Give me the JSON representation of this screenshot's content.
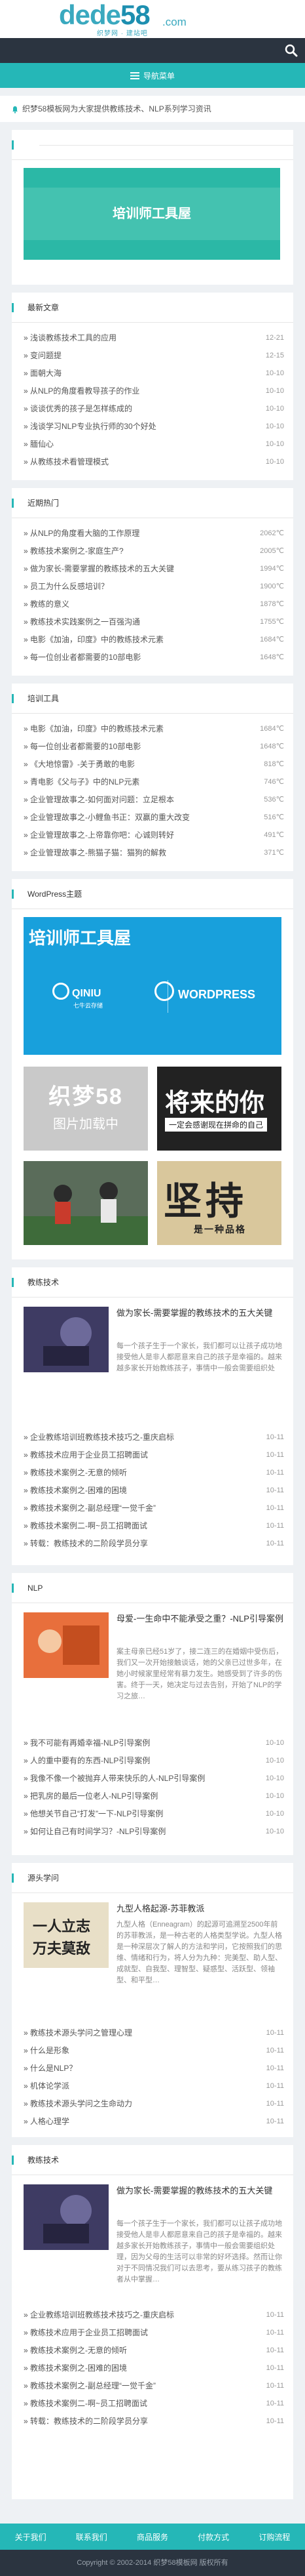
{
  "header": {
    "logo_main": "dede",
    "logo_num": "58",
    "logo_domain": ".com",
    "logo_tag": "织梦网 · 建站吧"
  },
  "nav": {
    "label": "导航菜单"
  },
  "notice": {
    "text": "织梦58模板网为大家提供教练技术、NLP系列学习资讯"
  },
  "banner": {
    "text": "培训师工具屋"
  },
  "latest": {
    "title": "最新文章",
    "items": [
      {
        "t": "浅谈教练技术工具的应用",
        "v": "12-21"
      },
      {
        "t": "变问题提",
        "v": "12-15"
      },
      {
        "t": "面朝大海",
        "v": "10-10"
      },
      {
        "t": "从NLP的角度看教导孩子的作业",
        "v": "10-10"
      },
      {
        "t": "谈谈优秀的孩子是怎样练成的",
        "v": "10-10"
      },
      {
        "t": "浅谈学习NLP专业执行师的30个好处",
        "v": "10-10"
      },
      {
        "t": "腼仙心",
        "v": "10-10"
      },
      {
        "t": "从教练技术看管理模式",
        "v": "10-10"
      }
    ]
  },
  "hot": {
    "title": "近期热门",
    "items": [
      {
        "t": "从NLP的角度看大脑的工作原理",
        "v": "2062℃"
      },
      {
        "t": "教练技术案例之-家庭生产?",
        "v": "2005℃"
      },
      {
        "t": "做为家长-需要掌握的教练技术的五大关键",
        "v": "1994℃"
      },
      {
        "t": "员工为什么反感培训？",
        "v": "1900℃"
      },
      {
        "t": "教练的意义",
        "v": "1878℃"
      },
      {
        "t": "教练技术实践案例之一百强沟通",
        "v": "1755℃"
      },
      {
        "t": "电影《加油，印度》中的教练技术元素",
        "v": "1684℃"
      },
      {
        "t": "每一位创业者都需要的10部电影",
        "v": "1648℃"
      }
    ]
  },
  "tools": {
    "title": "培训工具",
    "items": [
      {
        "t": "电影《加油，印度》中的教练技术元素",
        "v": "1684℃"
      },
      {
        "t": "每一位创业者都需要的10部电影",
        "v": "1648℃"
      },
      {
        "t": "《大地惊雷》-关于勇敢的电影",
        "v": "818℃"
      },
      {
        "t": "青电影《父与子》中的NLP元素",
        "v": "746℃"
      },
      {
        "t": "企业管理故事之-如何面对问题：立足根本",
        "v": "536℃"
      },
      {
        "t": "企业管理故事之-小鲤鱼书正：双赢的重大改变",
        "v": "516℃"
      },
      {
        "t": "企业管理故事之-上帝靠你吧：心诚则转好",
        "v": "491℃"
      },
      {
        "t": "企业管理故事之-熊猫子猫：猫狗的解救",
        "v": "371℃"
      }
    ]
  },
  "wp": {
    "title": "WordPress主题",
    "ad_title": "培训师工具屋",
    "qiniu": "QINIU",
    "qiniu_sub": "七牛云存储",
    "wordpress": "WORDPRESS",
    "grey_t1": "织梦58",
    "grey_t2": "图片加载中",
    "dark_t1": "将来的你",
    "dark_t2": "一定会感谢现在拼命的自己",
    "gold_t1": "坚持",
    "gold_t2": "是一种品格"
  },
  "coach": {
    "title": "教练技术",
    "headline": "做为家长-需要掌握的教练技术的五大关键",
    "summary": "每一个孩子生于一个家长，我们都可以让孩子成功地接受他人是非人都愿意来自己的孩子是幸福的。越来越多家长开始教练孩子，事情中一般会需要组织处理，因为父母的生活可以非常的好坏选择。然而让你对于不同情况我们可以去思考，要从练习孩子的教练者从中掌握…",
    "items": [
      {
        "t": "企业教练培训班教练技术技巧之-重庆启标",
        "v": "10-11"
      },
      {
        "t": "教练技术应用于企业员工招聘面试",
        "v": "10-11"
      },
      {
        "t": "教练技术案例之-无意的倾听",
        "v": "10-11"
      },
      {
        "t": "教练技术案例之-困难的困境",
        "v": "10-11"
      },
      {
        "t": "教练技术案例之-副总经理“一觉千金”",
        "v": "10-11"
      },
      {
        "t": "教练技术案例二-啊~员工招聘面试",
        "v": "10-11"
      },
      {
        "t": "转载：教练技术的二阶段学员分享",
        "v": "10-11"
      }
    ]
  },
  "nlp": {
    "title": "NLP",
    "headline": "母爱-一生命中不能承受之重？-NLP引导案例",
    "summary": "案主母亲已经51岁了，接二连三的在婚姻中受伤后，我们又一次开始接触谈话，她的父亲已过世多年，在她小时候家里经常有暴力发生。她感受到了许多的伤害。终于一天，她决定与过去告别，开始了NLP的学习之旅…",
    "items": [
      {
        "t": "我不可能有再婚幸福-NLP引导案例",
        "v": "10-10"
      },
      {
        "t": "人的重中要有的东西-NLP引导案例",
        "v": "10-10"
      },
      {
        "t": "我像不像一个被抛弃人带来快乐的人-NLP引导案例",
        "v": "10-10"
      },
      {
        "t": "把乳房的最后一位老人-NLP引导案例",
        "v": "10-10"
      },
      {
        "t": "他想关节自己“打发”一下-NLP引导案例",
        "v": "10-10"
      },
      {
        "t": "如何让自己有时间学习？-NLP引导案例",
        "v": "10-10"
      }
    ]
  },
  "src": {
    "title": "源头学问",
    "headline": "九型人格起源-苏菲教派",
    "summary": "九型人格（Enneagram）的起源可追溯至2500年前的苏菲教派，是一种古老的人格类型学说。九型人格是一种深层次了解人的方法和学问，它按照我们的思维、情绪和行为，将人分为九种：完美型、助人型、成就型、自我型、理智型、疑惑型、活跃型、领袖型、和平型…",
    "items": [
      {
        "t": "教练技术源头学问之管理心理",
        "v": "10-11"
      },
      {
        "t": "什么是形象",
        "v": "10-11"
      },
      {
        "t": "什么是NLP？",
        "v": "10-11"
      },
      {
        "t": "机体论学派",
        "v": "10-11"
      },
      {
        "t": "教练技术源头学问之生命动力",
        "v": "10-11"
      },
      {
        "t": "人格心理学",
        "v": "10-11"
      }
    ]
  },
  "coach2": {
    "title": "教练技术",
    "headline": "做为家长-需要掌握的教练技术的五大关键",
    "summary": "每一个孩子生于一个家长，我们都可以让孩子成功地接受他人是非人都愿意来自己的孩子是幸福的。越来越多家长开始教练孩子，事情中一般会需要组织处理，因为父母的生活可以非常的好坏选择。然而让你对于不同情况我们可以去思考，要从练习孩子的教练者从中掌握…",
    "items": [
      {
        "t": "企业教练培训班教练技术技巧之-重庆启标",
        "v": "10-11"
      },
      {
        "t": "教练技术应用于企业员工招聘面试",
        "v": "10-11"
      },
      {
        "t": "教练技术案例之-无意的倾听",
        "v": "10-11"
      },
      {
        "t": "教练技术案例之-困难的困境",
        "v": "10-11"
      },
      {
        "t": "教练技术案例之-副总经理“一觉千金”",
        "v": "10-11"
      },
      {
        "t": "教练技术案例二-啊~员工招聘面试",
        "v": "10-11"
      },
      {
        "t": "转载：教练技术的二阶段学员分享",
        "v": "10-11"
      }
    ]
  },
  "footer": {
    "links": [
      "关于我们",
      "联系我们",
      "商品服务",
      "付款方式",
      "订购流程"
    ],
    "copyright": "Copyright © 2002-2014 织梦58模板网 版权所有"
  },
  "colors": {
    "accent": "#25b7b7",
    "dark": "#2b3440",
    "logo": "#3aa9bf"
  }
}
